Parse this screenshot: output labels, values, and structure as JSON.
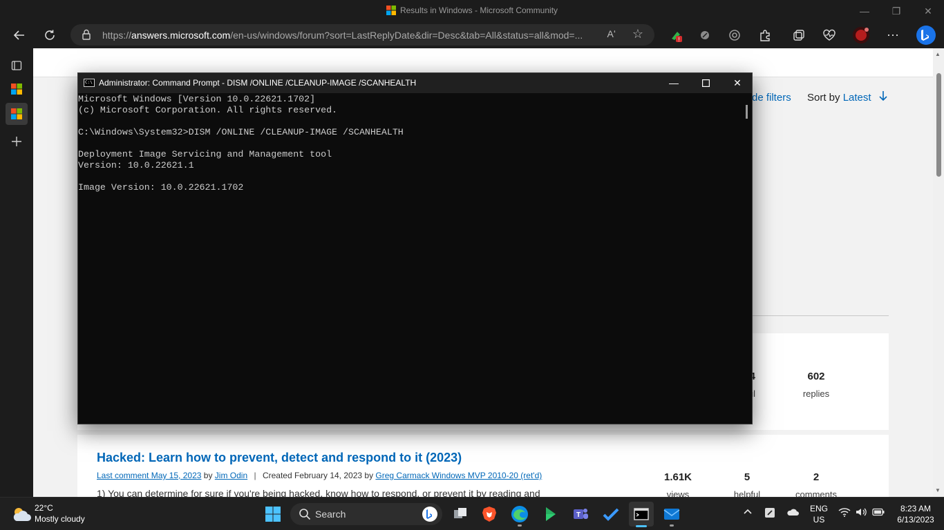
{
  "browser": {
    "window_title": "Results in Windows - Microsoft Community",
    "url_prefix": "https://",
    "url_domain": "answers.microsoft.com",
    "url_rest": "/en-us/windows/forum?sort=LastReplyDate&dir=Desc&tab=All&status=all&mod=...",
    "read_aloud": "Aʻ"
  },
  "page": {
    "filters_label": "de filters",
    "sort_by_label": "Sort by",
    "sort_value": "Latest",
    "card1": {
      "stat_partial_num": "4",
      "stat_partial_label": "ful",
      "replies_num": "602",
      "replies_label": "replies"
    },
    "post": {
      "title": "Hacked: Learn how to prevent, detect and respond to it (2023)",
      "last_comment": "Last comment May 15, 2023",
      "by1": "by",
      "last_author": "Jim Odin",
      "created": "Created February 14, 2023",
      "by2": "by",
      "creator": "Greg Carmack Windows MVP 2010-20 (ret'd)",
      "snippet": "1) You can determine for sure if you're being hacked, know how to respond, or prevent it by reading and",
      "views_num": "1.61K",
      "views_label": "views",
      "helpful_num": "5",
      "helpful_label": "helpful",
      "comments_num": "2",
      "comments_label": "comments"
    }
  },
  "cmd": {
    "title": "Administrator: Command Prompt - DISM  /ONLINE /CLEANUP-IMAGE /SCANHEALTH",
    "icon_text": "C:\\",
    "output": "Microsoft Windows [Version 10.0.22621.1702]\n(c) Microsoft Corporation. All rights reserved.\n\nC:\\Windows\\System32>DISM /ONLINE /CLEANUP-IMAGE /SCANHEALTH\n\nDeployment Image Servicing and Management tool\nVersion: 10.0.22621.1\n\nImage Version: 10.0.22621.1702"
  },
  "taskbar": {
    "weather_temp": "22°C",
    "weather_cond": "Mostly cloudy",
    "search_label": "Search",
    "lang_line1": "ENG",
    "lang_line2": "US",
    "time": "8:23 AM",
    "date": "6/13/2023"
  },
  "colors": {
    "accent": "#0067b8",
    "console_bg": "#0c0c0c",
    "taskbar_bg": "#202020",
    "chrome_bg": "#1c1c1c"
  }
}
